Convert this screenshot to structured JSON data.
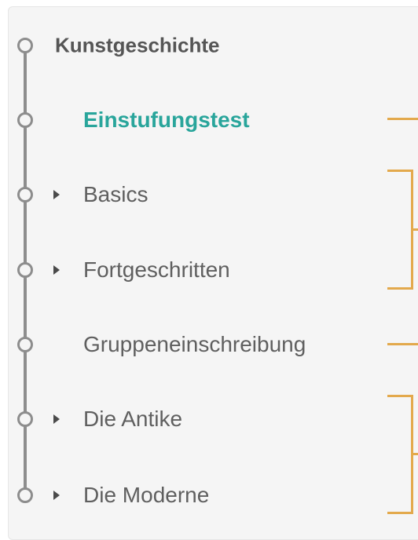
{
  "course": {
    "title": "Kunstgeschichte",
    "items": [
      {
        "label": "Einstufungstest",
        "active": true,
        "expandable": false
      },
      {
        "label": "Basics",
        "active": false,
        "expandable": true
      },
      {
        "label": "Fortgeschritten",
        "active": false,
        "expandable": true
      },
      {
        "label": "Gruppeneinschreibung",
        "active": false,
        "expandable": false
      },
      {
        "label": "Die Antike",
        "active": false,
        "expandable": true
      },
      {
        "label": "Die Moderne",
        "active": false,
        "expandable": true
      }
    ]
  },
  "colors": {
    "accent": "#29a59b",
    "bracket": "#e3a94c",
    "timeline": "#8d8d8d"
  }
}
